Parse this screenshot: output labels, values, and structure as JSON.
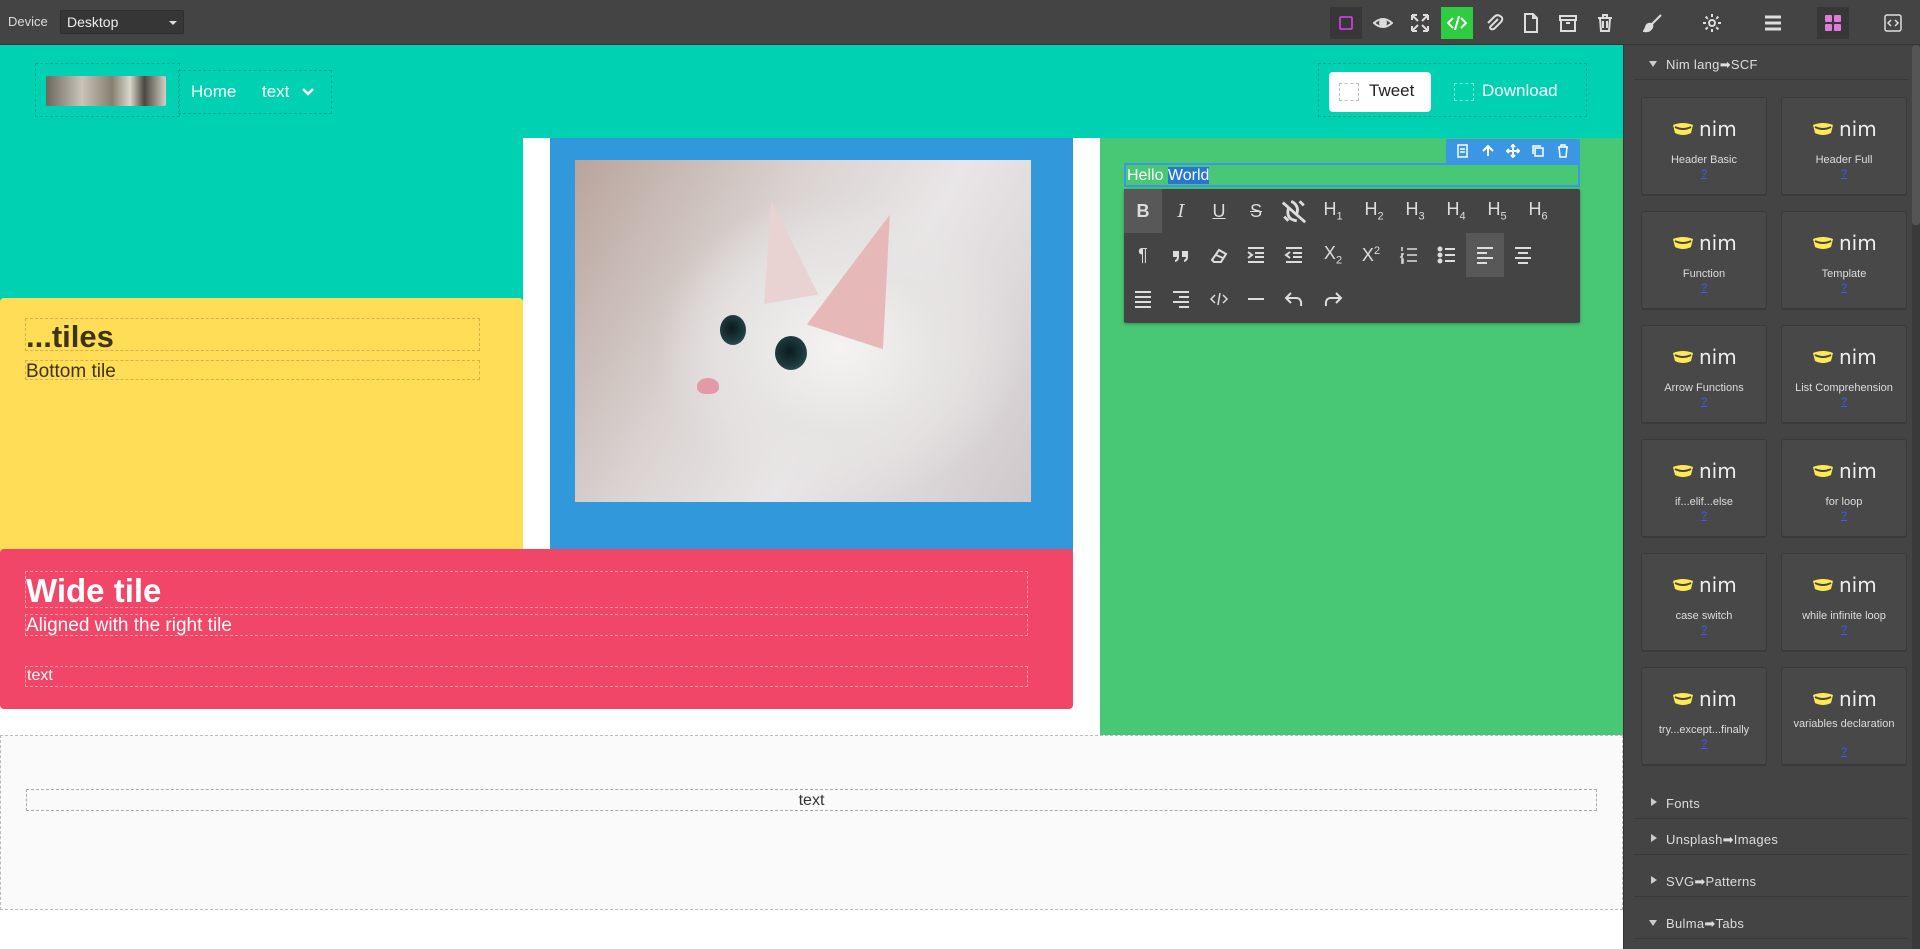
{
  "topbar": {
    "device_label": "Device",
    "device_value": "Desktop",
    "icons": [
      "square-outline-icon",
      "eye-icon",
      "fullscreen-icon",
      "code-icon",
      "import-icon",
      "new-page-icon",
      "archive-icon",
      "trash-icon",
      "paint-brush-icon",
      "settings-gear-icon",
      "layers-icon",
      "blocks-grid-icon",
      "code-view-icon"
    ],
    "accent_active": "#2ecc40"
  },
  "navbar": {
    "home": "Home",
    "dropdown": "text",
    "tweet": "Tweet",
    "download": "Download",
    "bg": "#00d1b2"
  },
  "tiles": {
    "yellow_title": "...tiles",
    "yellow_subtitle": "Bottom tile",
    "red_title": "Wide tile",
    "red_subtitle": "Aligned with the right tile",
    "red_text": "text",
    "colors": {
      "teal": "#00d1b2",
      "yellow": "#ffdd57",
      "blue": "#3298dc",
      "green": "#48c774",
      "red": "#f14668"
    }
  },
  "editor": {
    "hello": "Hello",
    "world": "World",
    "row1": [
      "B",
      "I",
      "U",
      "S",
      "unlink",
      "H1",
      "H2",
      "H3",
      "H4",
      "H5",
      "H6"
    ],
    "row2": [
      "¶",
      "quote",
      "eraser",
      "indent",
      "outdent",
      "subscript",
      "superscript",
      "ordered-list",
      "unordered-list",
      "align-left",
      "align-center"
    ],
    "row3": [
      "justify",
      "align-right",
      "code",
      "hr",
      "undo",
      "redo"
    ]
  },
  "footer": {
    "text": "text"
  },
  "sidebar": {
    "category_open": "Nim lang➡SCF",
    "blocks": [
      {
        "label": "Header Basic",
        "q": "?"
      },
      {
        "label": "Header Full",
        "q": "?"
      },
      {
        "label": "Function",
        "q": "?"
      },
      {
        "label": "Template",
        "q": "?"
      },
      {
        "label": "Arrow Functions",
        "q": "?"
      },
      {
        "label": "List Comprehension",
        "q": "?"
      },
      {
        "label": "if...elif...else",
        "q": "?"
      },
      {
        "label": "for loop",
        "q": "?"
      },
      {
        "label": "case switch",
        "q": "?"
      },
      {
        "label": "while infinite loop",
        "q": "?"
      },
      {
        "label": "try...except...finally",
        "q": "?"
      },
      {
        "label": "variables declaration",
        "q": "?"
      }
    ],
    "logo_text": "nim",
    "categories": [
      "Fonts",
      "Unsplash➡Images",
      "SVG➡Patterns",
      "Bulma➡Tabs"
    ]
  }
}
